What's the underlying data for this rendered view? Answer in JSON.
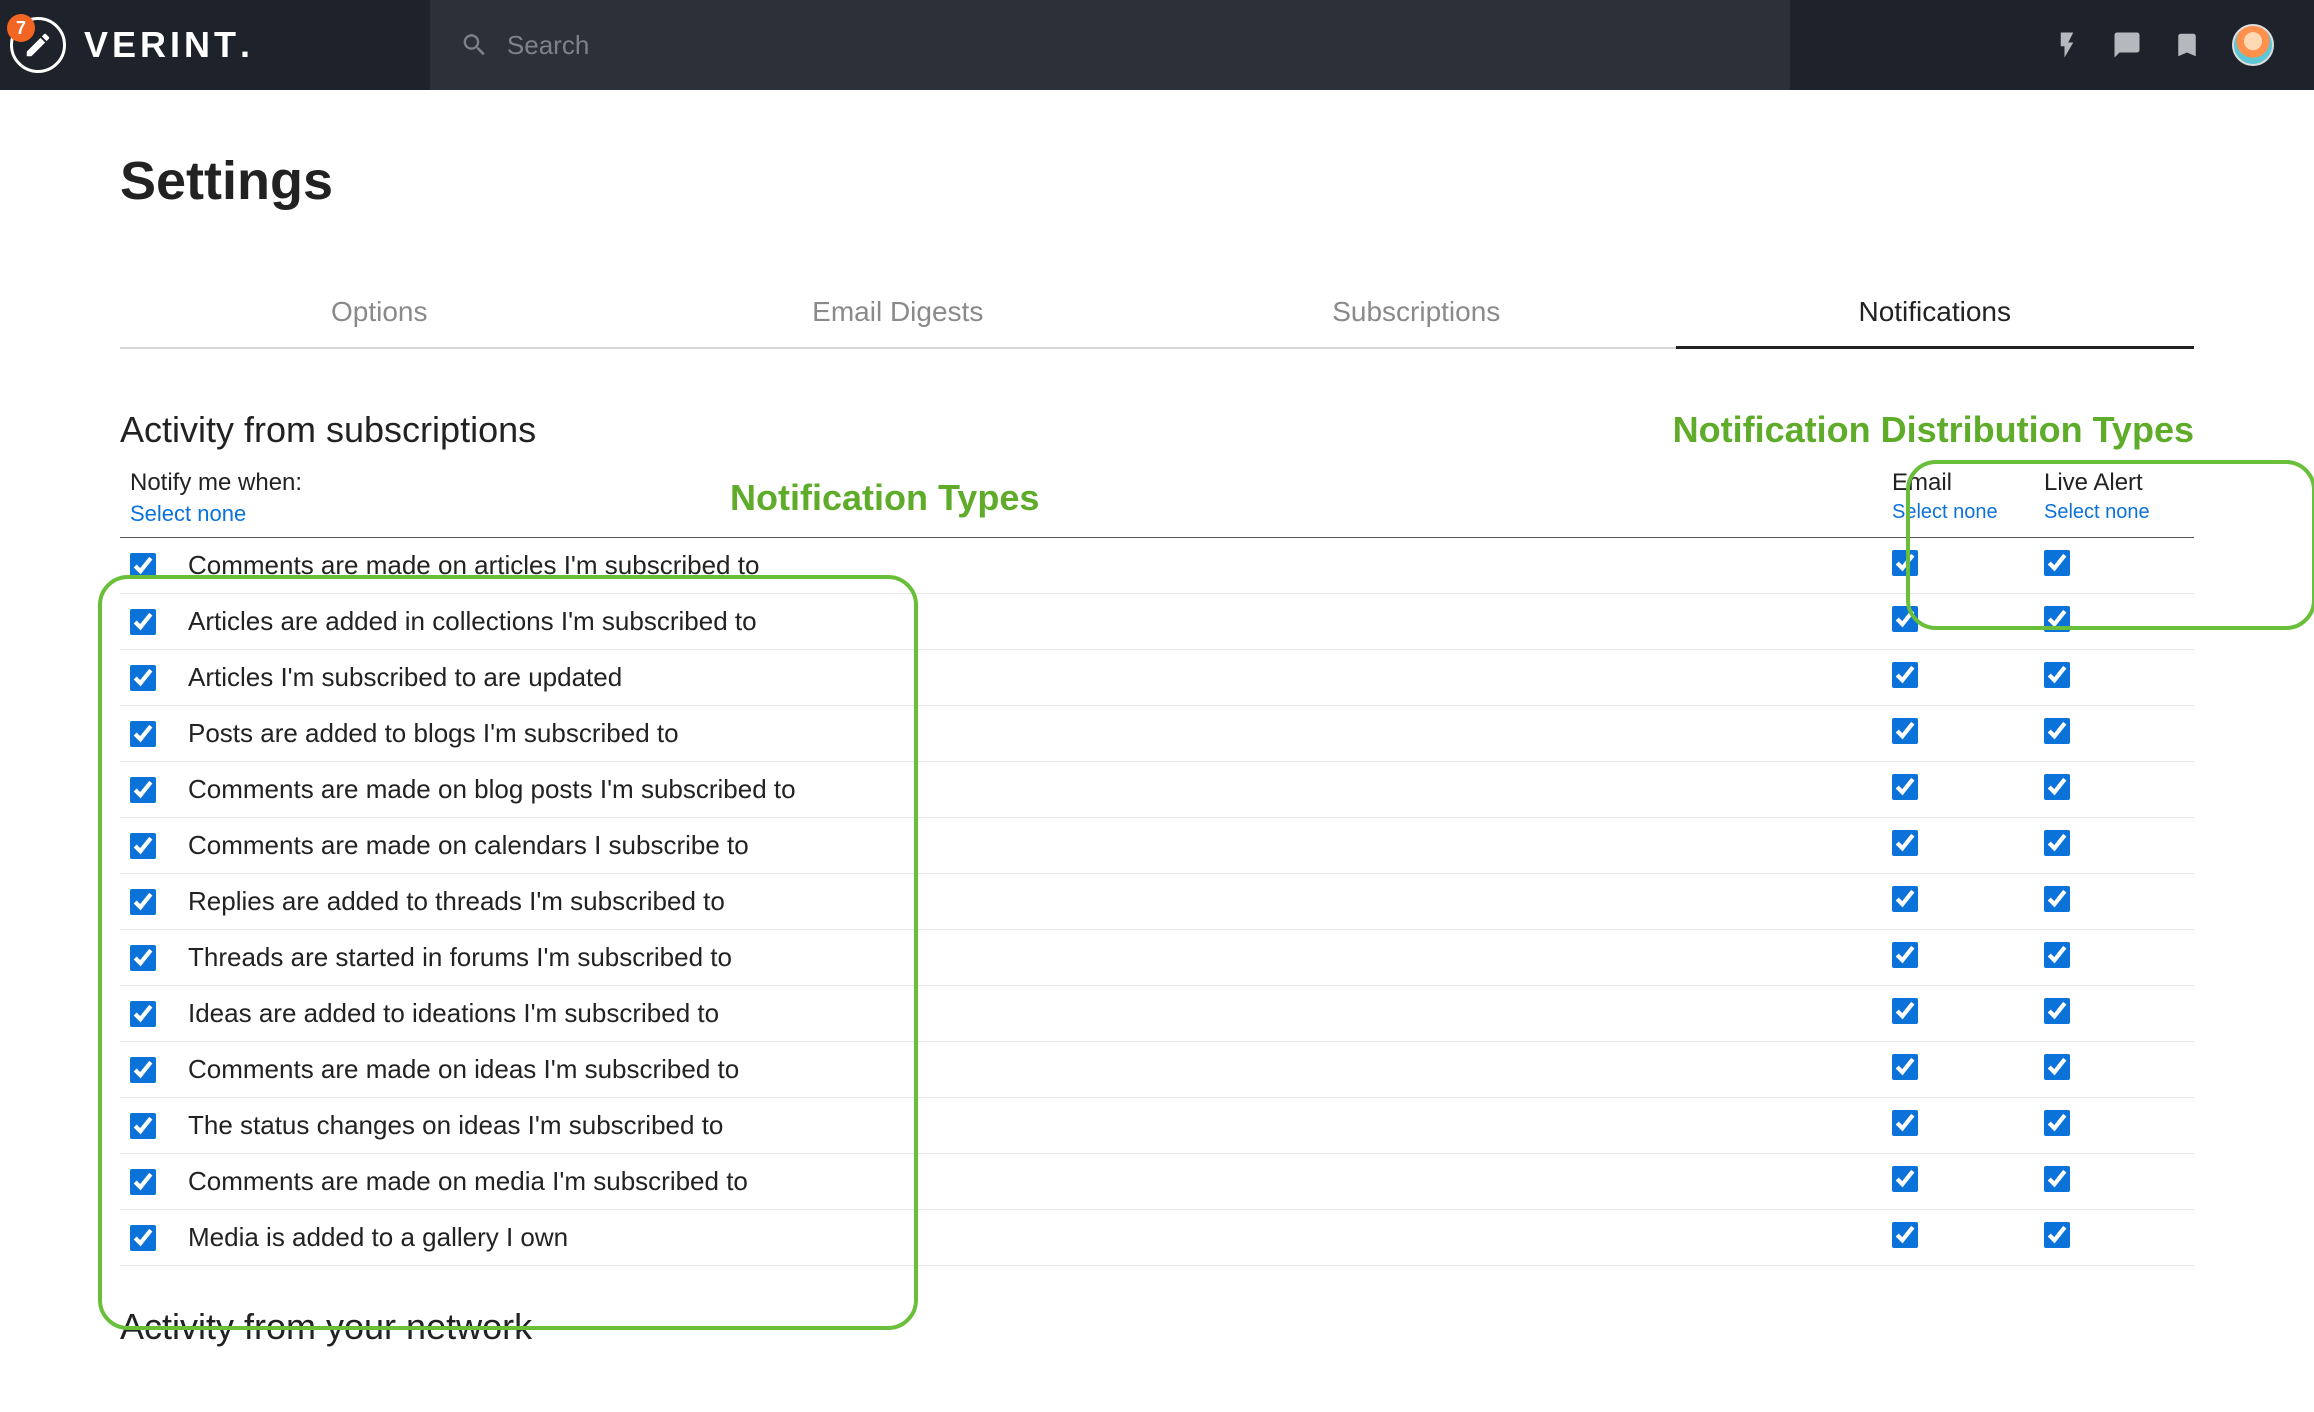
{
  "header": {
    "badge_count": "7",
    "brand": "VERINT",
    "search_placeholder": "Search"
  },
  "page_title": "Settings",
  "tabs": [
    "Options",
    "Email Digests",
    "Subscriptions",
    "Notifications"
  ],
  "active_tab": 3,
  "section1_title": "Activity from subscriptions",
  "annotation_dist": "Notification Distribution Types",
  "notify_label": "Notify me when:",
  "select_none": "Select none",
  "annotation_types": "Notification Types",
  "dist_cols": [
    "Email",
    "Live Alert"
  ],
  "rows": [
    "Comments are made on articles I'm subscribed to",
    "Articles are added in collections I'm subscribed to",
    "Articles I'm subscribed to are updated",
    "Posts are added to blogs I'm subscribed to",
    "Comments are made on blog posts I'm subscribed to",
    "Comments are made on calendars I subscribe to",
    "Replies are added to threads I'm subscribed to",
    "Threads are started in forums I'm subscribed to",
    "Ideas are added to ideations I'm subscribed to",
    "Comments are made on ideas I'm subscribed to",
    "The status changes on ideas I'm subscribed to",
    "Comments are made on media I'm subscribed to",
    "Media is added to a gallery I own"
  ],
  "section2_title": "Activity from your network"
}
